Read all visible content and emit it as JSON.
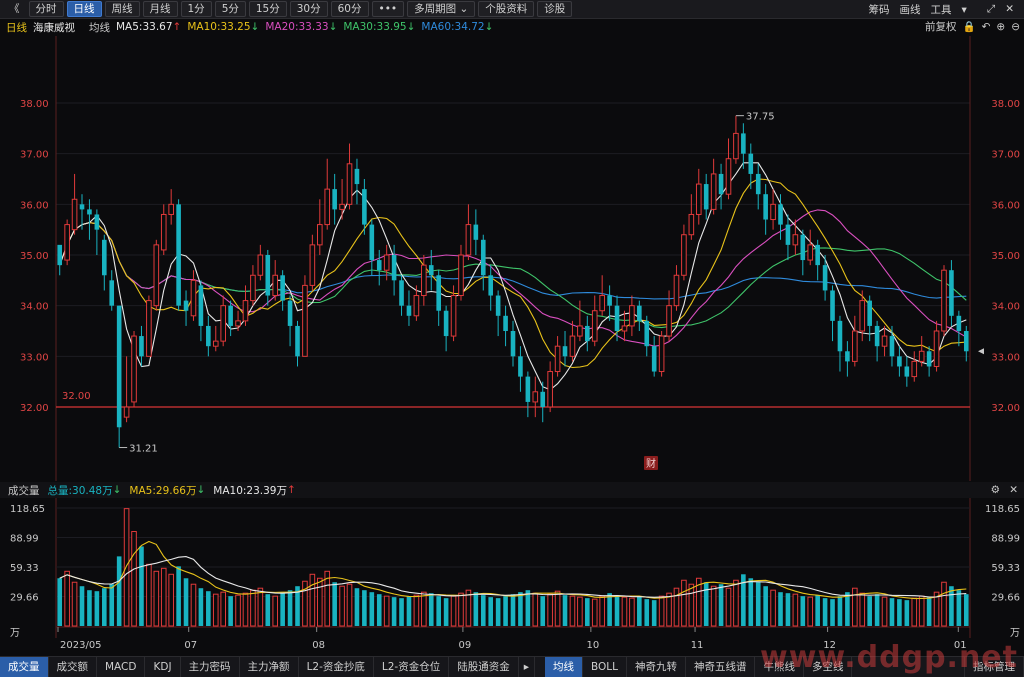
{
  "toolbar": {
    "back": "《",
    "buttons": [
      "分时",
      "日线",
      "周线",
      "月线",
      "1分",
      "5分",
      "15分",
      "30分",
      "60分",
      "•••",
      "多周期图",
      "个股资料",
      "诊股"
    ],
    "active": "日线",
    "right": [
      "筹码",
      "画线",
      "工具"
    ]
  },
  "info": {
    "period": "日线",
    "stock": "海康威视",
    "ma_label": "均线",
    "ma5": "MA5:33.67",
    "ma10": "MA10:33.25",
    "ma20": "MA20:33.33",
    "ma30": "MA30:33.95",
    "ma60": "MA60:34.72",
    "restore": "前复权",
    "colors": {
      "ma5": "#e8e8e8",
      "ma10": "#e8c21a",
      "ma20": "#d94fbf",
      "ma30": "#3fc46a",
      "ma60": "#2f8bdc",
      "up": "#e03a3a",
      "down": "#19b3c1"
    }
  },
  "price_axis": [
    "38.00",
    "37.00",
    "36.00",
    "35.00",
    "34.00",
    "33.00",
    "32.00"
  ],
  "annotations": {
    "high": "37.75",
    "low": "31.21",
    "line": "32.00",
    "fin": "财"
  },
  "volume": {
    "label": "成交量",
    "total": "总量:30.48万",
    "ma5": "MA5:29.66万",
    "ma10": "MA10:23.39万",
    "axis": [
      "118.65",
      "88.99",
      "59.33",
      "29.66",
      "万"
    ]
  },
  "x_axis": [
    "2023/05",
    "07",
    "08",
    "09",
    "10",
    "11",
    "12",
    "01"
  ],
  "bottom_tabs": [
    "成交量",
    "成交额",
    "MACD",
    "KDJ",
    "主力密码",
    "主力净额",
    "L2-资金抄底",
    "L2-资金仓位",
    "陆股通资金",
    "均线",
    "BOLL",
    "神奇九转",
    "神奇五线谱",
    "牛熊线",
    "多空线",
    "指标管理"
  ],
  "watermark": "www.ddgp.net",
  "chart_data": {
    "type": "candlestick",
    "price_range": [
      31.0,
      38.9
    ],
    "volume_range": [
      0,
      125
    ],
    "candles": [
      [
        35.2,
        34.8,
        35.1,
        34.6
      ],
      [
        34.9,
        35.6,
        35.7,
        34.8
      ],
      [
        35.5,
        36.1,
        36.6,
        35.4
      ],
      [
        36.0,
        35.9,
        36.2,
        35.5
      ],
      [
        35.9,
        35.8,
        36.1,
        35.3
      ],
      [
        35.8,
        35.5,
        35.9,
        35.0
      ],
      [
        35.3,
        34.6,
        35.4,
        34.3
      ],
      [
        34.5,
        34.0,
        34.7,
        33.9
      ],
      [
        34.0,
        31.6,
        34.0,
        31.2
      ],
      [
        31.8,
        32.0,
        33.0,
        31.7
      ],
      [
        32.1,
        33.4,
        33.5,
        32.0
      ],
      [
        33.4,
        33.0,
        33.6,
        32.8
      ],
      [
        33.0,
        34.1,
        34.2,
        33.0
      ],
      [
        34.0,
        35.2,
        35.3,
        33.9
      ],
      [
        35.1,
        35.8,
        36.0,
        35.0
      ],
      [
        35.8,
        36.0,
        36.3,
        35.6
      ],
      [
        36.0,
        34.0,
        36.1,
        33.9
      ],
      [
        34.1,
        33.9,
        34.3,
        33.6
      ],
      [
        33.8,
        34.5,
        34.7,
        33.7
      ],
      [
        34.4,
        33.6,
        34.5,
        33.3
      ],
      [
        33.6,
        33.2,
        33.8,
        33.0
      ],
      [
        33.2,
        33.3,
        33.6,
        33.1
      ],
      [
        33.3,
        34.0,
        34.2,
        33.2
      ],
      [
        34.0,
        33.6,
        34.1,
        33.4
      ],
      [
        33.6,
        33.7,
        33.9,
        33.5
      ],
      [
        33.7,
        34.1,
        34.4,
        33.6
      ],
      [
        34.1,
        34.6,
        34.8,
        34.0
      ],
      [
        34.6,
        35.0,
        35.2,
        34.5
      ],
      [
        35.0,
        34.2,
        35.1,
        34.0
      ],
      [
        34.2,
        34.6,
        34.9,
        34.1
      ],
      [
        34.6,
        34.1,
        34.7,
        33.9
      ],
      [
        34.1,
        33.6,
        34.2,
        33.2
      ],
      [
        33.6,
        33.0,
        33.7,
        32.8
      ],
      [
        33.0,
        34.4,
        34.6,
        33.0
      ],
      [
        34.4,
        35.2,
        35.4,
        34.3
      ],
      [
        35.2,
        35.6,
        36.1,
        35.0
      ],
      [
        35.6,
        36.3,
        36.9,
        35.5
      ],
      [
        36.3,
        35.9,
        36.6,
        35.6
      ],
      [
        35.9,
        36.0,
        36.5,
        35.7
      ],
      [
        36.0,
        36.8,
        37.2,
        35.9
      ],
      [
        36.7,
        36.4,
        36.9,
        36.0
      ],
      [
        36.3,
        35.6,
        36.5,
        35.4
      ],
      [
        35.6,
        34.9,
        35.7,
        34.6
      ],
      [
        34.9,
        34.7,
        35.1,
        34.4
      ],
      [
        34.7,
        35.0,
        35.2,
        34.5
      ],
      [
        35.0,
        34.5,
        35.2,
        34.2
      ],
      [
        34.5,
        34.0,
        34.6,
        33.8
      ],
      [
        34.0,
        33.8,
        34.3,
        33.6
      ],
      [
        33.8,
        34.2,
        34.4,
        33.7
      ],
      [
        34.2,
        34.8,
        35.0,
        34.0
      ],
      [
        34.8,
        34.6,
        35.1,
        34.3
      ],
      [
        34.6,
        33.9,
        34.7,
        33.6
      ],
      [
        33.9,
        33.4,
        34.0,
        33.1
      ],
      [
        33.4,
        34.2,
        34.4,
        33.3
      ],
      [
        34.2,
        35.0,
        35.2,
        34.1
      ],
      [
        35.0,
        35.6,
        36.0,
        34.9
      ],
      [
        35.6,
        35.3,
        35.9,
        35.0
      ],
      [
        35.3,
        34.6,
        35.4,
        34.3
      ],
      [
        34.6,
        34.2,
        34.8,
        33.9
      ],
      [
        34.2,
        33.8,
        34.3,
        33.4
      ],
      [
        33.8,
        33.5,
        34.0,
        33.2
      ],
      [
        33.5,
        33.0,
        33.7,
        32.8
      ],
      [
        33.0,
        32.6,
        33.2,
        32.3
      ],
      [
        32.6,
        32.1,
        32.7,
        31.8
      ],
      [
        32.1,
        32.3,
        32.6,
        31.8
      ],
      [
        32.3,
        32.0,
        32.5,
        31.7
      ],
      [
        32.0,
        32.7,
        32.9,
        31.9
      ],
      [
        32.7,
        33.2,
        33.4,
        32.6
      ],
      [
        33.2,
        33.0,
        33.5,
        32.8
      ],
      [
        33.0,
        33.4,
        33.7,
        32.9
      ],
      [
        33.4,
        33.6,
        34.1,
        33.3
      ],
      [
        33.6,
        33.3,
        33.8,
        33.1
      ],
      [
        33.3,
        33.9,
        34.2,
        33.2
      ],
      [
        33.9,
        34.2,
        34.6,
        33.8
      ],
      [
        34.2,
        34.0,
        34.4,
        33.7
      ],
      [
        34.0,
        33.5,
        34.2,
        33.3
      ],
      [
        33.5,
        33.6,
        33.9,
        33.3
      ],
      [
        33.6,
        34.0,
        34.2,
        33.4
      ],
      [
        34.0,
        33.7,
        34.1,
        33.5
      ],
      [
        33.7,
        33.2,
        33.8,
        33.0
      ],
      [
        33.2,
        32.7,
        33.4,
        32.6
      ],
      [
        32.7,
        33.4,
        33.5,
        32.6
      ],
      [
        33.4,
        34.0,
        34.3,
        33.3
      ],
      [
        34.0,
        34.6,
        34.8,
        33.9
      ],
      [
        34.6,
        35.4,
        35.6,
        34.5
      ],
      [
        35.4,
        35.8,
        36.2,
        35.3
      ],
      [
        35.8,
        36.4,
        36.7,
        35.6
      ],
      [
        36.4,
        35.9,
        36.6,
        35.7
      ],
      [
        35.9,
        36.6,
        36.9,
        35.8
      ],
      [
        36.6,
        36.2,
        36.8,
        35.9
      ],
      [
        36.2,
        36.9,
        37.3,
        36.1
      ],
      [
        36.9,
        37.4,
        37.75,
        36.8
      ],
      [
        37.4,
        37.0,
        37.6,
        36.7
      ],
      [
        37.0,
        36.6,
        37.2,
        36.3
      ],
      [
        36.6,
        36.2,
        36.8,
        35.9
      ],
      [
        36.2,
        35.7,
        36.4,
        35.4
      ],
      [
        35.7,
        36.0,
        36.3,
        35.5
      ],
      [
        36.0,
        35.6,
        36.2,
        35.3
      ],
      [
        35.6,
        35.2,
        35.8,
        34.9
      ],
      [
        35.2,
        35.4,
        35.7,
        35.0
      ],
      [
        35.4,
        34.9,
        35.5,
        34.6
      ],
      [
        34.9,
        35.2,
        35.5,
        34.8
      ],
      [
        35.2,
        34.8,
        35.3,
        34.5
      ],
      [
        34.8,
        34.3,
        35.0,
        34.1
      ],
      [
        34.3,
        33.7,
        34.4,
        33.3
      ],
      [
        33.7,
        33.1,
        33.8,
        32.7
      ],
      [
        33.1,
        32.9,
        33.3,
        32.6
      ],
      [
        32.9,
        33.5,
        33.8,
        32.8
      ],
      [
        33.5,
        34.1,
        34.3,
        33.3
      ],
      [
        34.1,
        33.6,
        34.2,
        33.3
      ],
      [
        33.6,
        33.2,
        33.7,
        32.9
      ],
      [
        33.2,
        33.4,
        33.6,
        33.0
      ],
      [
        33.4,
        33.0,
        33.6,
        32.8
      ],
      [
        33.0,
        32.8,
        33.2,
        32.6
      ],
      [
        32.8,
        32.6,
        33.0,
        32.4
      ],
      [
        32.6,
        32.9,
        33.1,
        32.5
      ],
      [
        32.9,
        33.1,
        33.4,
        32.8
      ],
      [
        33.1,
        32.8,
        33.2,
        32.6
      ],
      [
        32.8,
        33.5,
        33.7,
        32.7
      ],
      [
        33.5,
        34.7,
        34.8,
        33.4
      ],
      [
        34.7,
        33.8,
        34.9,
        33.6
      ],
      [
        33.8,
        33.5,
        33.9,
        33.2
      ],
      [
        33.5,
        33.1,
        33.6,
        32.9
      ]
    ],
    "volumes": [
      48,
      55,
      44,
      40,
      36,
      35,
      38,
      42,
      70,
      118,
      95,
      80,
      62,
      55,
      58,
      52,
      60,
      48,
      42,
      38,
      35,
      32,
      34,
      30,
      31,
      33,
      36,
      38,
      32,
      30,
      34,
      36,
      40,
      45,
      52,
      48,
      55,
      44,
      40,
      42,
      38,
      36,
      34,
      32,
      30,
      29,
      28,
      30,
      31,
      34,
      33,
      30,
      28,
      30,
      33,
      36,
      34,
      31,
      29,
      28,
      30,
      32,
      34,
      36,
      33,
      30,
      32,
      35,
      31,
      30,
      29,
      28,
      27,
      30,
      33,
      31,
      29,
      28,
      30,
      27,
      26,
      30,
      33,
      38,
      46,
      42,
      48,
      44,
      40,
      42,
      38,
      46,
      52,
      48,
      44,
      40,
      36,
      34,
      33,
      32,
      30,
      29,
      31,
      28,
      27,
      30,
      34,
      38,
      33,
      30,
      32,
      29,
      28,
      27,
      26,
      28,
      30,
      29,
      34,
      44,
      40,
      36,
      32
    ]
  }
}
